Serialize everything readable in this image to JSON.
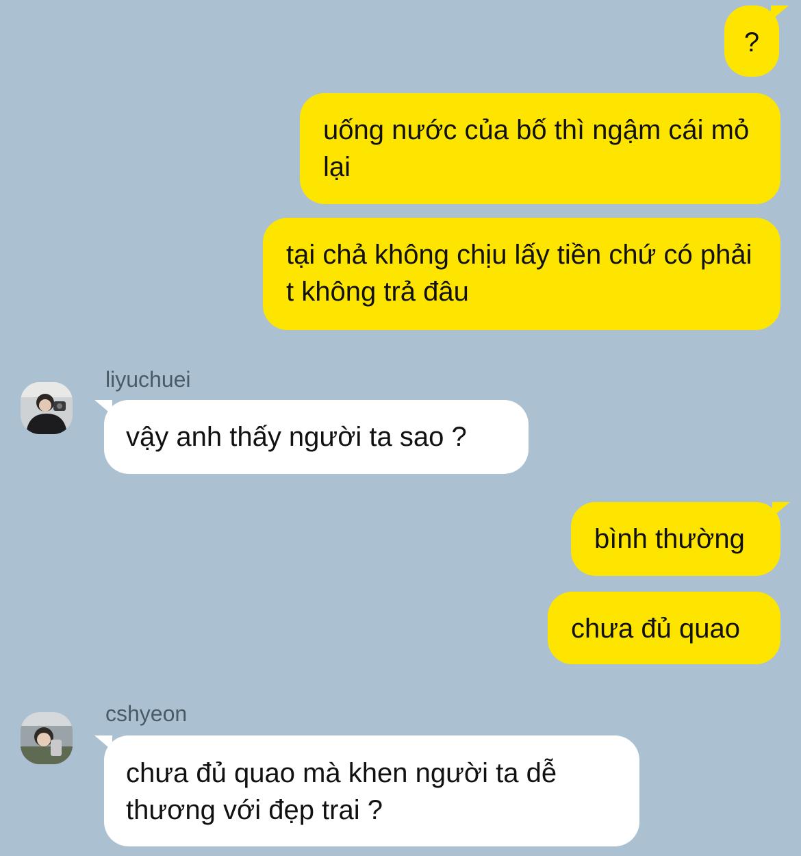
{
  "messages": [
    {
      "from": "me",
      "text": "?"
    },
    {
      "from": "me",
      "text": "uống nước của bố thì ngậm cái mỏ lại"
    },
    {
      "from": "me",
      "text": "tại chả không chịu lấy tiền chứ có phải t không trả đâu"
    },
    {
      "from": "liyuchuei",
      "sender": "liyuchuei",
      "text": "vậy anh thấy người ta sao ?"
    },
    {
      "from": "me",
      "text": "bình thường"
    },
    {
      "from": "me",
      "text": "chưa đủ quao"
    },
    {
      "from": "cshyeon",
      "sender": "cshyeon",
      "text": "chưa đủ quao mà khen người ta dễ thương với đẹp trai ?"
    }
  ],
  "colors": {
    "background": "#abc1d1",
    "my_bubble": "#fee500",
    "their_bubble": "#ffffff"
  }
}
